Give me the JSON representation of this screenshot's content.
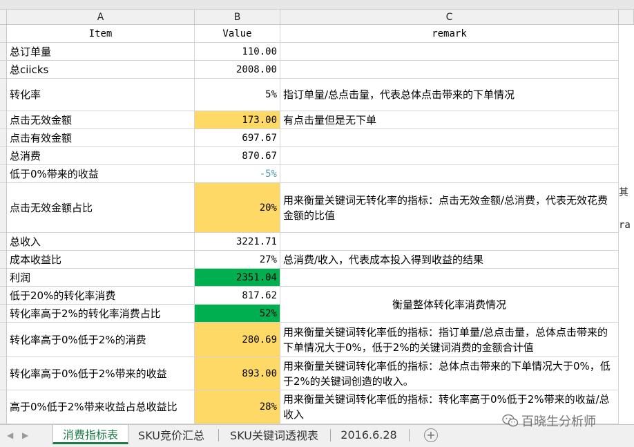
{
  "columns": {
    "a": "A",
    "b": "B",
    "c": "C"
  },
  "header_row": {
    "item": "Item",
    "value": "Value",
    "remark": "remark"
  },
  "rows": [
    {
      "item": "总订单量",
      "value": "110.00",
      "remark": ""
    },
    {
      "item": "总ciicks",
      "value": "2008.00",
      "remark": ""
    },
    {
      "item": "转化率",
      "value": "5%",
      "remark": "指订单量/总点击量，代表总体点击带来的下单情况"
    },
    {
      "item": "点击无效金额",
      "value": "173.00",
      "remark": "有点击量但是无下单"
    },
    {
      "item": "点击有效金额",
      "value": "697.67",
      "remark": ""
    },
    {
      "item": "总消费",
      "value": "870.67",
      "remark": ""
    },
    {
      "item": "低于0%带来的收益",
      "value": "-5%",
      "remark": ""
    },
    {
      "item": "点击无效金额占比",
      "value": "20%",
      "remark": "用来衡量关键词无转化率的指标：点击无效金额/总消费，代表无效花费金额的比值"
    },
    {
      "item": "总收入",
      "value": "3221.71",
      "remark": ""
    },
    {
      "item": "成本收益比",
      "value": "27%",
      "remark": "总消费/收入，代表成本投入得到收益的结果"
    },
    {
      "item": "利润",
      "value": "2351.04",
      "remark": ""
    },
    {
      "item": "低于20%的转化率消费",
      "value": "817.62",
      "remark": "衡量整体转化率消费情况"
    },
    {
      "item": "转化率高于2%的转化率消费占比",
      "value": "52%",
      "remark": ""
    },
    {
      "item": "转化率高于0%低于2%的消费",
      "value": "280.69",
      "remark": "用来衡量关键词转化率低的指标：指订单量/总点击量，总体点击带来的下单情况大于0%，低于2%的关键词消费的金额合计值"
    },
    {
      "item": "转化率高于0%低于2%带来的收益",
      "value": "893.00",
      "remark": "用来衡量关键词转化率低的指标：总体点击带来的下单情况大于0%，低于2%的关键词创造的收入。"
    },
    {
      "item": "高于0%低于2%带来收益占总收益比",
      "value": "28%",
      "remark": "用来衡量关键词转化率低的指标：转化率高于0%低于2%带来的收益/总收入"
    }
  ],
  "side_clip": {
    "top": "其",
    "bottom": "ra"
  },
  "sheet_tabs": [
    "消费指标表",
    "SKU竞价汇总",
    "SKU关键词透视表",
    "2016.6.28"
  ],
  "add_sheet_icon": "plus-circle-icon",
  "watermark": {
    "icon": "wechat-icon",
    "text": "百晓生分析师"
  },
  "colors": {
    "yellow": "#ffd966",
    "green": "#00b050",
    "active_tab": "#1e7a46",
    "negative_value": "#4f9fb0"
  }
}
